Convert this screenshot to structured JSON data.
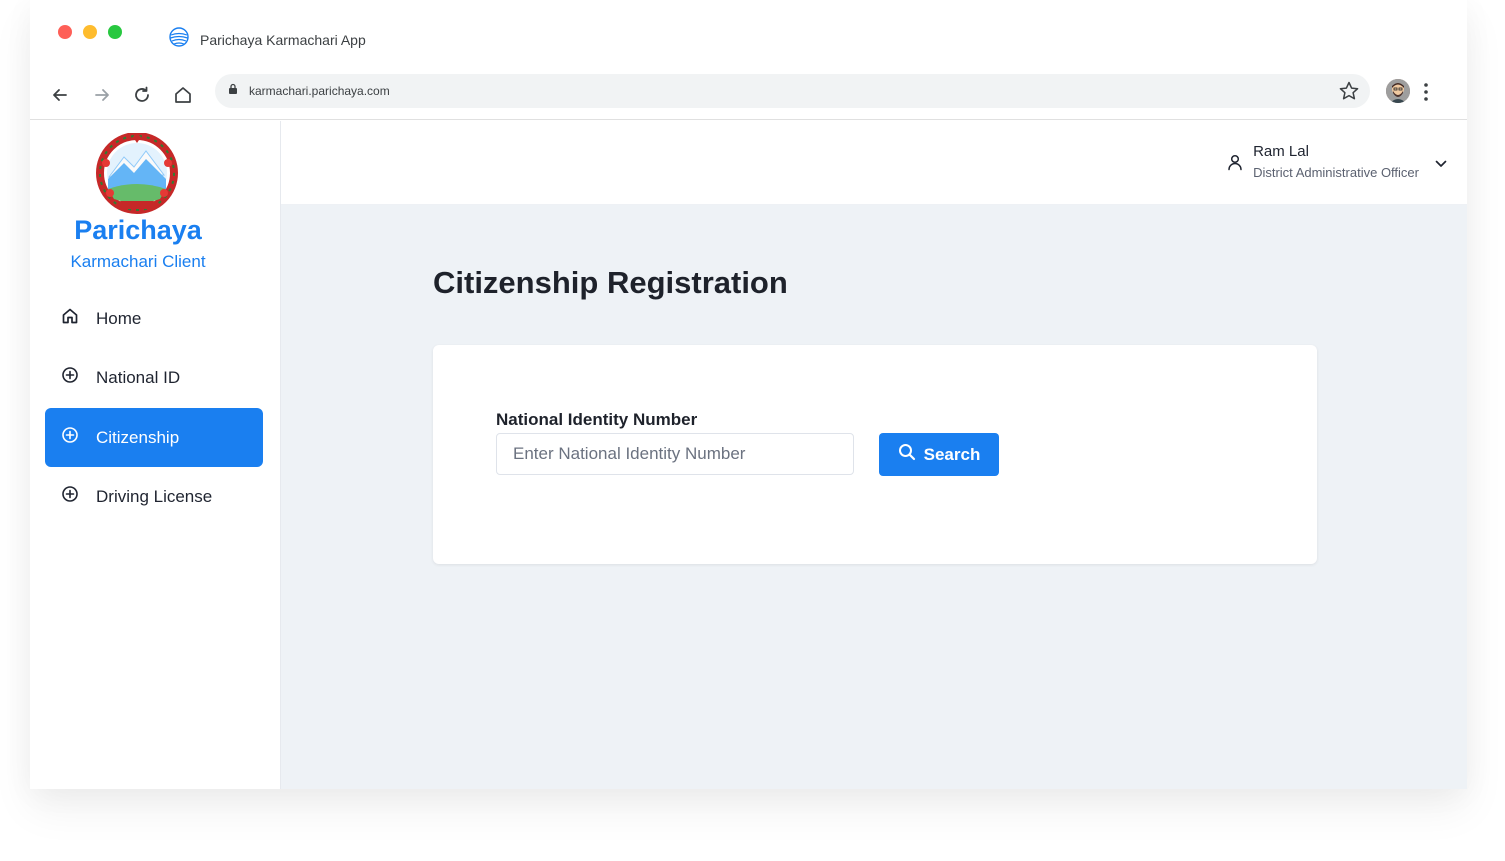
{
  "browser": {
    "tab_title": "Parichaya Karmachari App",
    "url": "karmachari.parichaya.com"
  },
  "sidebar": {
    "brand": "Parichaya",
    "brand_sub": "Karmachari Client",
    "items": [
      {
        "label": "Home",
        "icon": "home-icon",
        "active": false
      },
      {
        "label": "National ID",
        "icon": "plus-circle-icon",
        "active": false
      },
      {
        "label": "Citizenship",
        "icon": "plus-circle-icon",
        "active": true
      },
      {
        "label": "Driving License",
        "icon": "plus-circle-icon",
        "active": false
      }
    ]
  },
  "user": {
    "name": "Ram Lal",
    "role": "District Administrative Officer"
  },
  "main": {
    "title": "Citizenship Registration",
    "form": {
      "label": "National Identity Number",
      "placeholder": "Enter National Identity Number",
      "value": "",
      "button_label": "Search"
    }
  },
  "colors": {
    "accent": "#1a7ff0",
    "main_bg": "#eef2f6"
  }
}
